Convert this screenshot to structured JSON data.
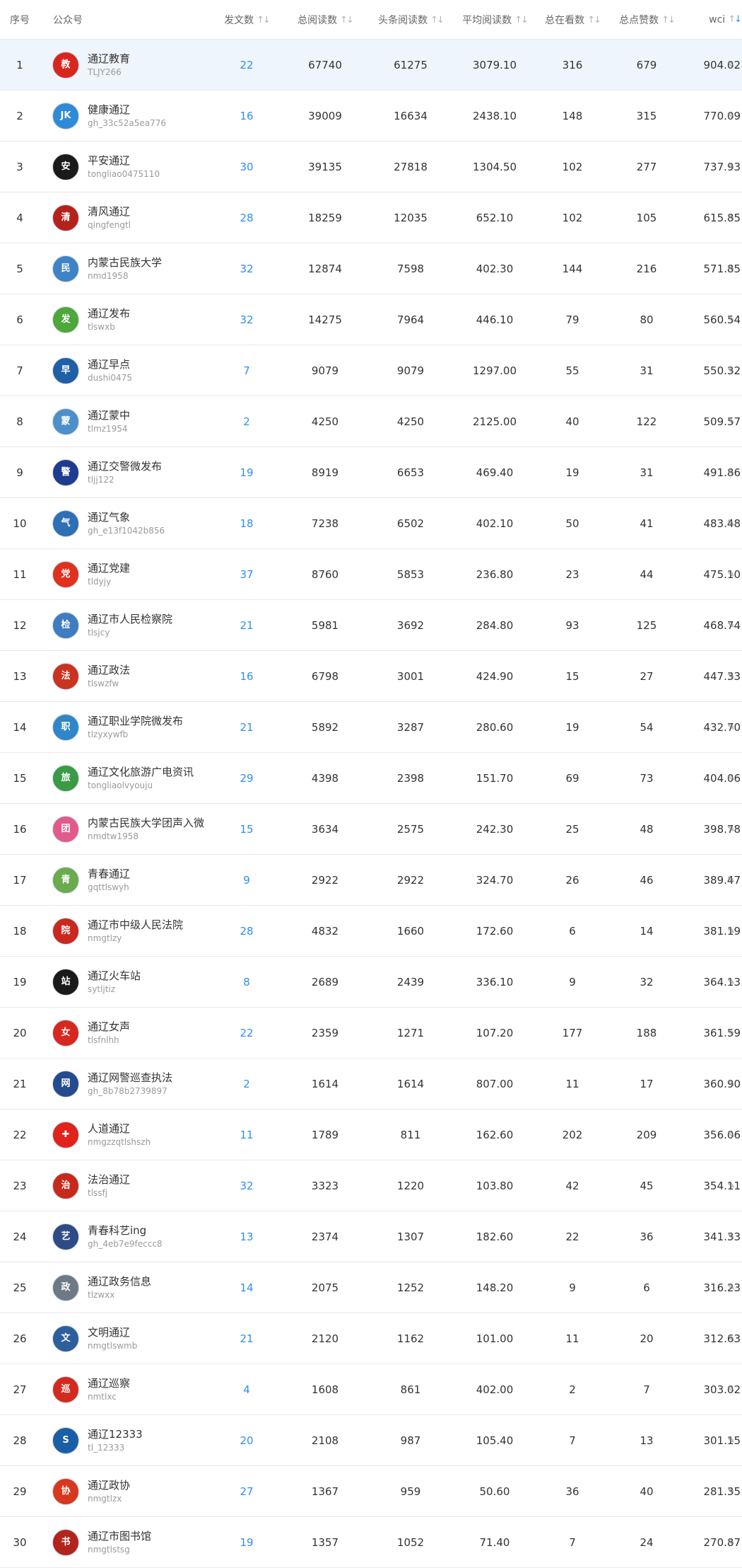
{
  "columns": {
    "rank": "序号",
    "account": "公众号",
    "articles": "发文数",
    "total_reads": "总阅读数",
    "headline_reads": "头条阅读数",
    "avg_reads": "平均阅读数",
    "watching": "总在看数",
    "likes": "总点赞数",
    "wci": "wci"
  },
  "sort_icon": "sort-arrows-icon",
  "edit_icon": "pencil-icon",
  "colors": {
    "link": "#2c8ef8",
    "highlight_row": "#eef5fd",
    "border": "#e8e8e8"
  },
  "rows": [
    {
      "rank": "1",
      "name": "通辽教育",
      "id": "TLJY266",
      "articles": "22",
      "total": "67740",
      "head": "61275",
      "avg": "3079.10",
      "watch": "316",
      "like": "679",
      "wci": "904.02",
      "avatar_color": "#d7261e",
      "avatar_glyph": "教"
    },
    {
      "rank": "2",
      "name": "健康通辽",
      "id": "gh_33c52a5ea776",
      "articles": "16",
      "total": "39009",
      "head": "16634",
      "avg": "2438.10",
      "watch": "148",
      "like": "315",
      "wci": "770.09",
      "avatar_color": "#2f8ad8",
      "avatar_glyph": "JK"
    },
    {
      "rank": "3",
      "name": "平安通辽",
      "id": "tongliao0475110",
      "articles": "30",
      "total": "39135",
      "head": "27818",
      "avg": "1304.50",
      "watch": "102",
      "like": "277",
      "wci": "737.93",
      "avatar_color": "#1a1a1a",
      "avatar_glyph": "安"
    },
    {
      "rank": "4",
      "name": "清风通辽",
      "id": "qingfengtl",
      "articles": "28",
      "total": "18259",
      "head": "12035",
      "avg": "652.10",
      "watch": "102",
      "like": "105",
      "wci": "615.85",
      "avatar_color": "#b5221b",
      "avatar_glyph": "清"
    },
    {
      "rank": "5",
      "name": "内蒙古民族大学",
      "id": "nmd1958",
      "articles": "32",
      "total": "12874",
      "head": "7598",
      "avg": "402.30",
      "watch": "144",
      "like": "216",
      "wci": "571.85",
      "avatar_color": "#3d83c6",
      "avatar_glyph": "民"
    },
    {
      "rank": "6",
      "name": "通辽发布",
      "id": "tlswxb",
      "articles": "32",
      "total": "14275",
      "head": "7964",
      "avg": "446.10",
      "watch": "79",
      "like": "80",
      "wci": "560.54",
      "avatar_color": "#4fa63a",
      "avatar_glyph": "发"
    },
    {
      "rank": "7",
      "name": "通辽早点",
      "id": "dushi0475",
      "articles": "7",
      "total": "9079",
      "head": "9079",
      "avg": "1297.00",
      "watch": "55",
      "like": "31",
      "wci": "550.32",
      "avatar_color": "#1f5fa6",
      "avatar_glyph": "早"
    },
    {
      "rank": "8",
      "name": "通辽蒙中",
      "id": "tlmz1954",
      "articles": "2",
      "total": "4250",
      "head": "4250",
      "avg": "2125.00",
      "watch": "40",
      "like": "122",
      "wci": "509.57",
      "avatar_color": "#4d8fca",
      "avatar_glyph": "蒙"
    },
    {
      "rank": "9",
      "name": "通辽交警微发布",
      "id": "tljj122",
      "articles": "19",
      "total": "8919",
      "head": "6653",
      "avg": "469.40",
      "watch": "19",
      "like": "31",
      "wci": "491.86",
      "avatar_color": "#1e3b8f",
      "avatar_glyph": "警"
    },
    {
      "rank": "10",
      "name": "通辽气象",
      "id": "gh_e13f1042b856",
      "articles": "18",
      "total": "7238",
      "head": "6502",
      "avg": "402.10",
      "watch": "50",
      "like": "41",
      "wci": "483.48",
      "avatar_color": "#2e6fb5",
      "avatar_glyph": "气"
    },
    {
      "rank": "11",
      "name": "通辽党建",
      "id": "tldyjy",
      "articles": "37",
      "total": "8760",
      "head": "5853",
      "avg": "236.80",
      "watch": "23",
      "like": "44",
      "wci": "475.10",
      "avatar_color": "#e0301e",
      "avatar_glyph": "党"
    },
    {
      "rank": "12",
      "name": "通辽市人民检察院",
      "id": "tlsjcy",
      "articles": "21",
      "total": "5981",
      "head": "3692",
      "avg": "284.80",
      "watch": "93",
      "like": "125",
      "wci": "468.74",
      "avatar_color": "#3f7cc0",
      "avatar_glyph": "检"
    },
    {
      "rank": "13",
      "name": "通辽政法",
      "id": "tlswzfw",
      "articles": "16",
      "total": "6798",
      "head": "3001",
      "avg": "424.90",
      "watch": "15",
      "like": "27",
      "wci": "447.33",
      "avatar_color": "#c9331f",
      "avatar_glyph": "法"
    },
    {
      "rank": "14",
      "name": "通辽职业学院微发布",
      "id": "tlzyxywfb",
      "articles": "21",
      "total": "5892",
      "head": "3287",
      "avg": "280.60",
      "watch": "19",
      "like": "54",
      "wci": "432.70",
      "avatar_color": "#2f86c9",
      "avatar_glyph": "职"
    },
    {
      "rank": "15",
      "name": "通辽文化旅游广电资讯",
      "id": "tongliaolvyouju",
      "articles": "29",
      "total": "4398",
      "head": "2398",
      "avg": "151.70",
      "watch": "69",
      "like": "73",
      "wci": "404.06",
      "avatar_color": "#3a9a45",
      "avatar_glyph": "旅"
    },
    {
      "rank": "16",
      "name": "内蒙古民族大学团声入微",
      "id": "nmdtw1958",
      "articles": "15",
      "total": "3634",
      "head": "2575",
      "avg": "242.30",
      "watch": "25",
      "like": "48",
      "wci": "398.78",
      "avatar_color": "#e25a8c",
      "avatar_glyph": "团"
    },
    {
      "rank": "17",
      "name": "青春通辽",
      "id": "gqttlswyh",
      "articles": "9",
      "total": "2922",
      "head": "2922",
      "avg": "324.70",
      "watch": "26",
      "like": "46",
      "wci": "389.47",
      "avatar_color": "#6aab4d",
      "avatar_glyph": "青"
    },
    {
      "rank": "18",
      "name": "通辽市中级人民法院",
      "id": "nmgtlzy",
      "articles": "28",
      "total": "4832",
      "head": "1660",
      "avg": "172.60",
      "watch": "6",
      "like": "14",
      "wci": "381.19",
      "avatar_color": "#c8281e",
      "avatar_glyph": "院"
    },
    {
      "rank": "19",
      "name": "通辽火车站",
      "id": "sytljtiz",
      "articles": "8",
      "total": "2689",
      "head": "2439",
      "avg": "336.10",
      "watch": "9",
      "like": "32",
      "wci": "364.13",
      "avatar_color": "#1a1a1a",
      "avatar_glyph": "站"
    },
    {
      "rank": "20",
      "name": "通辽女声",
      "id": "tlsfnlhh",
      "articles": "22",
      "total": "2359",
      "head": "1271",
      "avg": "107.20",
      "watch": "177",
      "like": "188",
      "wci": "361.59",
      "avatar_color": "#d6281f",
      "avatar_glyph": "女"
    },
    {
      "rank": "21",
      "name": "通辽网警巡查执法",
      "id": "gh_8b78b2739897",
      "articles": "2",
      "total": "1614",
      "head": "1614",
      "avg": "807.00",
      "watch": "11",
      "like": "17",
      "wci": "360.90",
      "avatar_color": "#254a8e",
      "avatar_glyph": "网"
    },
    {
      "rank": "22",
      "name": "人道通辽",
      "id": "nmgzzqtlshszh",
      "articles": "11",
      "total": "1789",
      "head": "811",
      "avg": "162.60",
      "watch": "202",
      "like": "209",
      "wci": "356.06",
      "avatar_color": "#e0231b",
      "avatar_glyph": "✚"
    },
    {
      "rank": "23",
      "name": "法治通辽",
      "id": "tlssfj",
      "articles": "32",
      "total": "3323",
      "head": "1220",
      "avg": "103.80",
      "watch": "42",
      "like": "45",
      "wci": "354.11",
      "avatar_color": "#c62a1c",
      "avatar_glyph": "治"
    },
    {
      "rank": "24",
      "name": "青春科艺ing",
      "id": "gh_4eb7e9feccc8",
      "articles": "13",
      "total": "2374",
      "head": "1307",
      "avg": "182.60",
      "watch": "22",
      "like": "36",
      "wci": "341.33",
      "avatar_color": "#2d4c86",
      "avatar_glyph": "艺"
    },
    {
      "rank": "25",
      "name": "通辽政务信息",
      "id": "tlzwxx",
      "articles": "14",
      "total": "2075",
      "head": "1252",
      "avg": "148.20",
      "watch": "9",
      "like": "6",
      "wci": "316.23",
      "avatar_color": "#6d7a86",
      "avatar_glyph": "政"
    },
    {
      "rank": "26",
      "name": "文明通辽",
      "id": "nmgtlswmb",
      "articles": "21",
      "total": "2120",
      "head": "1162",
      "avg": "101.00",
      "watch": "11",
      "like": "20",
      "wci": "312.63",
      "avatar_color": "#2d5f9b",
      "avatar_glyph": "文"
    },
    {
      "rank": "27",
      "name": "通辽巡察",
      "id": "nmtlxc",
      "articles": "4",
      "total": "1608",
      "head": "861",
      "avg": "402.00",
      "watch": "2",
      "like": "7",
      "wci": "303.02",
      "avatar_color": "#d42a1d",
      "avatar_glyph": "巡"
    },
    {
      "rank": "28",
      "name": "通辽12333",
      "id": "tl_12333",
      "articles": "20",
      "total": "2108",
      "head": "987",
      "avg": "105.40",
      "watch": "7",
      "like": "13",
      "wci": "301.15",
      "avatar_color": "#1a5ea8",
      "avatar_glyph": "S"
    },
    {
      "rank": "29",
      "name": "通辽政协",
      "id": "nmgtlzx",
      "articles": "27",
      "total": "1367",
      "head": "959",
      "avg": "50.60",
      "watch": "36",
      "like": "40",
      "wci": "281.35",
      "avatar_color": "#d8381e",
      "avatar_glyph": "协"
    },
    {
      "rank": "30",
      "name": "通辽市图书馆",
      "id": "nmgtlstsg",
      "articles": "19",
      "total": "1357",
      "head": "1052",
      "avg": "71.40",
      "watch": "7",
      "like": "24",
      "wci": "270.87",
      "avatar_color": "#b3241c",
      "avatar_glyph": "书"
    }
  ]
}
